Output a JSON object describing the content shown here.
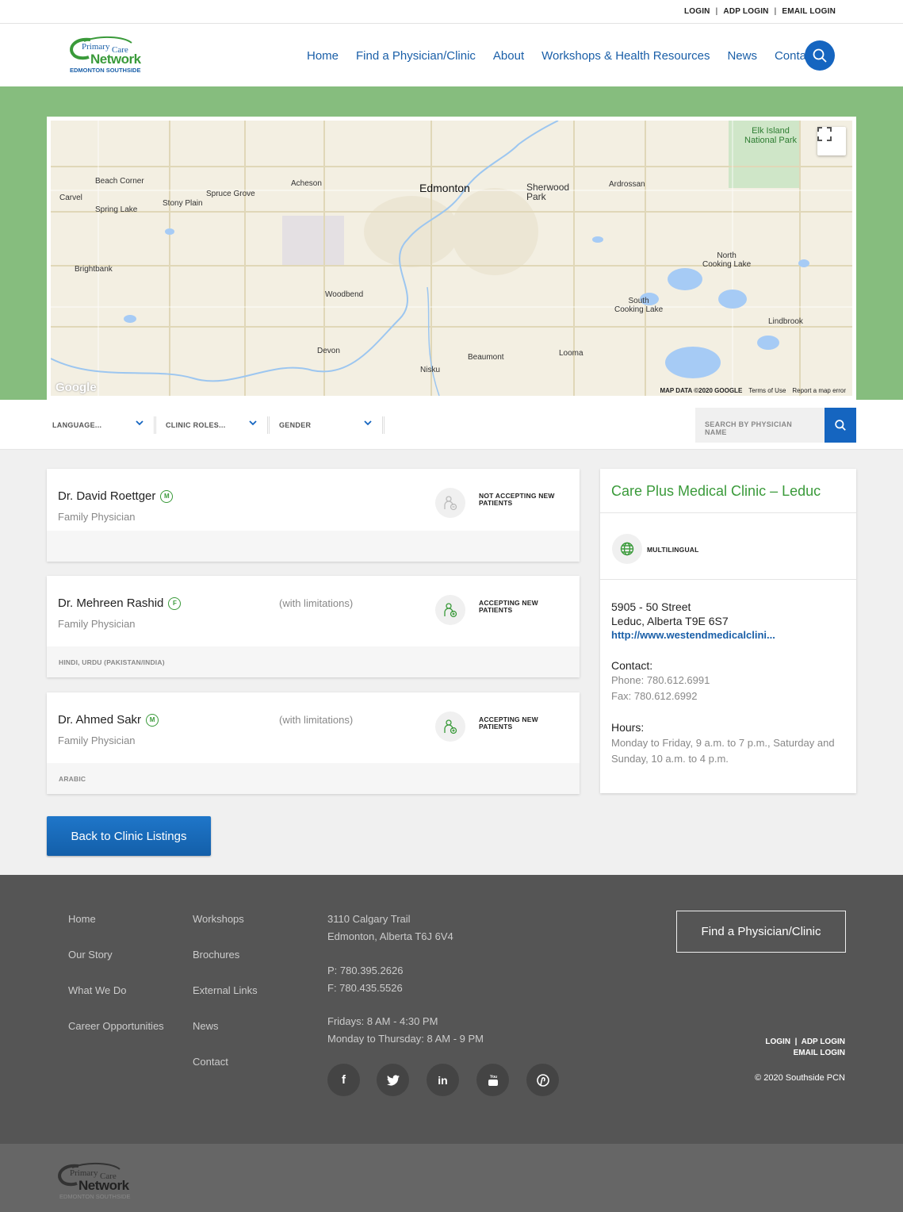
{
  "utility": {
    "login": "LOGIN",
    "adp_login": "ADP LOGIN",
    "email_login": "EMAIL LOGIN",
    "sep": "|"
  },
  "logo": {
    "line1": "Primary",
    "line2": "Care",
    "line3": "Network",
    "line4": "EDMONTON SOUTHSIDE"
  },
  "nav": [
    "Home",
    "Find a Physician/Clinic",
    "About",
    "Workshops & Health Resources",
    "News",
    "Contact"
  ],
  "map": {
    "labels": {
      "edmonton": "Edmonton",
      "sherwood": "Sherwood\nPark",
      "elk": "Elk Island\nNational Park",
      "beach": "Beach Corner",
      "carvel": "Carvel",
      "spring": "Spring Lake",
      "stony": "Stony Plain",
      "spruce": "Spruce Grove",
      "acheson": "Acheson",
      "ardrossan": "Ardrossan",
      "brightbank": "Brightbank",
      "woodbend": "Woodbend",
      "north_cooking": "North\nCooking Lake",
      "south_cooking": "South\nCooking Lake",
      "lindbrook": "Lindbrook",
      "devon": "Devon",
      "beaumont": "Beaumont",
      "looma": "Looma",
      "nisku": "Nisku"
    },
    "attribution": {
      "data": "MAP DATA ©2020 GOOGLE",
      "terms": "Terms of Use",
      "report": "Report a map error"
    },
    "google": "Google"
  },
  "filters": {
    "language": "LANGUAGE...",
    "roles": "CLINIC ROLES...",
    "gender": "GENDER",
    "search_placeholder": "SEARCH BY PHYSICIAN NAME"
  },
  "physicians": [
    {
      "name": "Dr. David Roettger",
      "gender": "M",
      "role": "Family Physician",
      "limit": "",
      "status": "NOT ACCEPTING NEW PATIENTS",
      "status_l1": "NOT ACCEPTING NEW",
      "status_l2": "PATIENTS",
      "languages": ""
    },
    {
      "name": "Dr. Mehreen Rashid",
      "gender": "F",
      "role": "Family Physician",
      "limit": "(with limitations)",
      "status": "ACCEPTING NEW PATIENTS",
      "status_l1": "ACCEPTING NEW",
      "status_l2": "PATIENTS",
      "languages": "HINDI, URDU (PAKISTAN/INDIA)"
    },
    {
      "name": "Dr. Ahmed Sakr",
      "gender": "M",
      "role": "Family Physician",
      "limit": "(with limitations)",
      "status": "ACCEPTING NEW PATIENTS",
      "status_l1": "ACCEPTING NEW",
      "status_l2": "PATIENTS",
      "languages": "ARABIC"
    }
  ],
  "clinic": {
    "title": "Care Plus Medical Clinic – Leduc",
    "feature": "MULTILINGUAL",
    "address1": "5905 - 50 Street",
    "address2": "Leduc, Alberta T9E 6S7",
    "url": "http://www.westendmedicalclini...",
    "contact_heading": "Contact:",
    "phone": "Phone: 780.612.6991",
    "fax": "Fax: 780.612.6992",
    "hours_heading": "Hours:",
    "hours": "Monday to Friday, 9 a.m. to 7 p.m., Saturday and Sunday, 10 a.m. to 4 p.m."
  },
  "back_button": "Back to Clinic Listings",
  "footer": {
    "col1": [
      "Home",
      "Our Story",
      "What We Do",
      "Career Opportunities"
    ],
    "col2": [
      "Workshops",
      "Brochures",
      "External Links",
      "News",
      "Contact"
    ],
    "address1": "3110 Calgary Trail",
    "address2": "Edmonton, Alberta T6J 6V4",
    "phone": "P: 780.395.2626",
    "fax": "F: 780.435.5526",
    "hours1": "Fridays: 8 AM - 4:30 PM",
    "hours2": "Monday to Thursday: 8 AM - 9 PM",
    "social": [
      "facebook-icon",
      "twitter-icon",
      "linkedin-icon",
      "youtube-icon",
      "pinterest-icon"
    ],
    "cta": "Find a Physician/Clinic",
    "login": "LOGIN",
    "adp_login": "ADP LOGIN",
    "email_login": "EMAIL LOGIN",
    "sep": "|",
    "copyright": "© 2020 Southside PCN"
  },
  "colors": {
    "brand_blue": "#1565c0",
    "brand_green": "#3a9a3a",
    "map_band": "#86bd7e",
    "footer": "#555555"
  }
}
